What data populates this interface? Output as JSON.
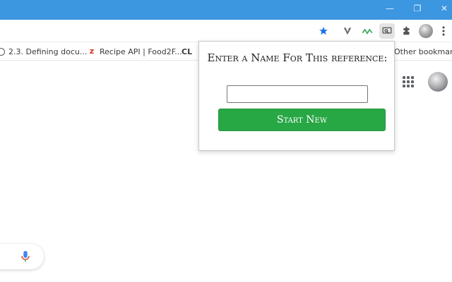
{
  "window": {
    "minimize_glyph": "—",
    "restore_glyph": "❐",
    "close_glyph": "✕"
  },
  "toolbar": {
    "icons": [
      "star-icon",
      "extension-v-icon",
      "extension-wave-icon",
      "extension-screen-icon",
      "puzzle-icon",
      "profile-avatar-icon",
      "kebab-menu-icon"
    ]
  },
  "bookmarks": {
    "items": [
      {
        "label": "2.3. Defining docu..."
      },
      {
        "label": "Recipe API | Food2F..."
      },
      {
        "label": "CL"
      },
      {
        "label": "Other bookmarks"
      }
    ]
  },
  "popup": {
    "title": "Enter a Name For This reference:",
    "input_value": "",
    "input_placeholder": "",
    "button_label": "Start New"
  },
  "colors": {
    "titlebar": "#3d96e0",
    "accent_button": "#28a745",
    "star": "#1a73e8"
  }
}
